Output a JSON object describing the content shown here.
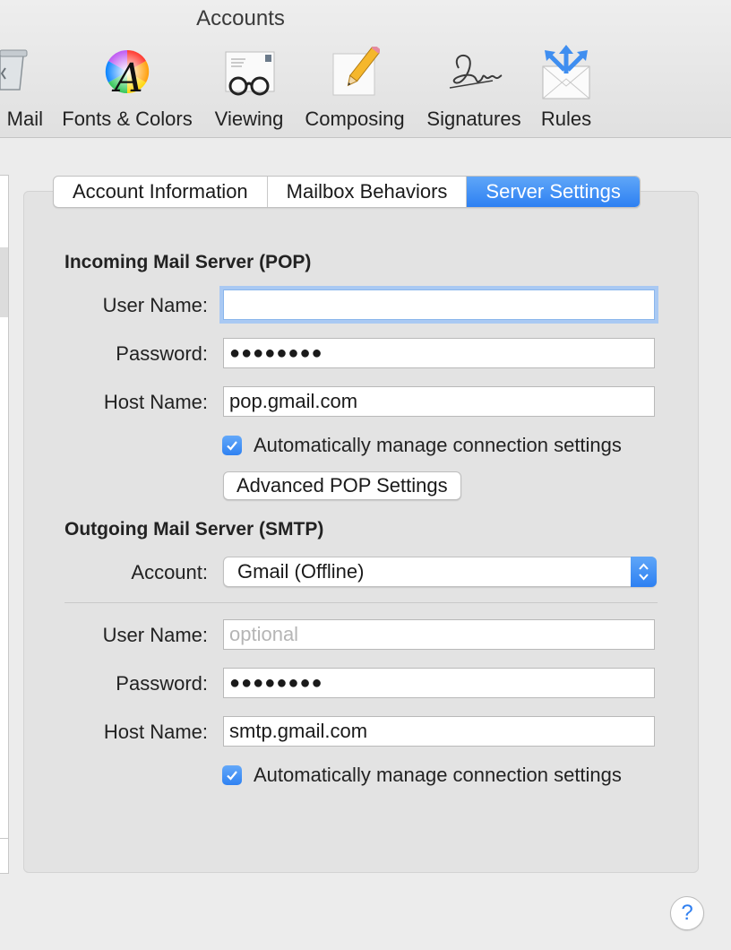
{
  "window": {
    "title": "Accounts"
  },
  "toolbar": {
    "items": [
      {
        "label": "Mail",
        "icon": "junk-mail-icon"
      },
      {
        "label": "Fonts & Colors",
        "icon": "fonts-colors-icon"
      },
      {
        "label": "Viewing",
        "icon": "viewing-glasses-icon"
      },
      {
        "label": "Composing",
        "icon": "pencil-icon"
      },
      {
        "label": "Signatures",
        "icon": "signature-icon"
      },
      {
        "label": "Rules",
        "icon": "rules-envelope-icon"
      }
    ]
  },
  "tabs": [
    {
      "label": "Account Information",
      "active": false
    },
    {
      "label": "Mailbox Behaviors",
      "active": false
    },
    {
      "label": "Server Settings",
      "active": true
    }
  ],
  "incoming": {
    "title": "Incoming Mail Server (POP)",
    "user_name_label": "User Name:",
    "user_name_value": "",
    "password_label": "Password:",
    "password_value": "●●●●●●●●",
    "host_label": "Host Name:",
    "host_value": "pop.gmail.com",
    "auto_manage_label": "Automatically manage connection settings",
    "auto_manage_checked": true,
    "advanced_button": "Advanced POP Settings"
  },
  "outgoing": {
    "title": "Outgoing Mail Server (SMTP)",
    "account_label": "Account:",
    "account_value": "Gmail (Offline)",
    "user_name_label": "User Name:",
    "user_name_placeholder": "optional",
    "password_label": "Password:",
    "password_value": "●●●●●●●●",
    "host_label": "Host Name:",
    "host_value": "smtp.gmail.com",
    "auto_manage_label": "Automatically manage connection settings",
    "auto_manage_checked": true
  },
  "help": {
    "label": "?"
  },
  "colors": {
    "accent": "#2f82f2",
    "panel": "#e3e3e3",
    "window": "#ececec"
  }
}
